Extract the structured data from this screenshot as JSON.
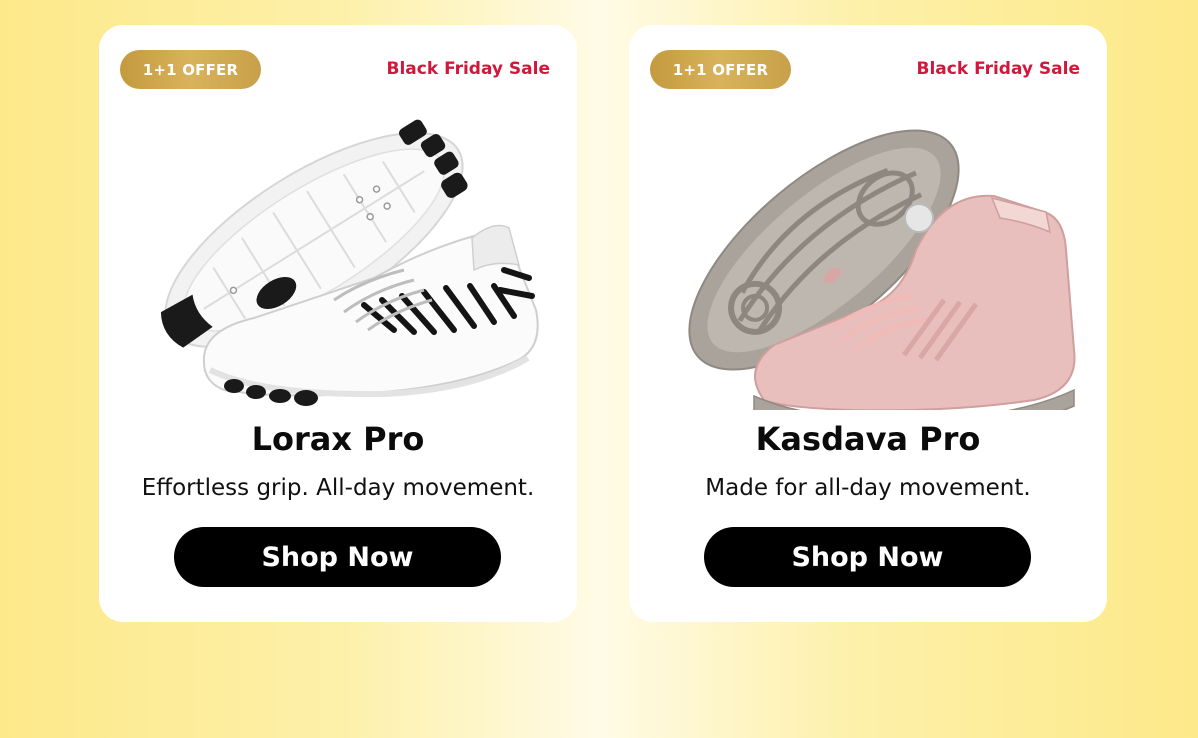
{
  "colors": {
    "badge_gold": "#c8a04a",
    "sale_red": "#d2173c",
    "button_black": "#000000",
    "card_bg": "#ffffff"
  },
  "products": [
    {
      "badge": "1+1 OFFER",
      "sale": "Black Friday Sale",
      "name": "Lorax Pro",
      "tagline": "Effortless grip. All-day movement.",
      "cta": "Shop Now",
      "image": "white-black-barefoot-shoes"
    },
    {
      "badge": "1+1 OFFER",
      "sale": "Black Friday Sale",
      "name": "Kasdava Pro",
      "tagline": "Made for all-day movement.",
      "cta": "Shop Now",
      "image": "pink-barefoot-boots"
    }
  ]
}
